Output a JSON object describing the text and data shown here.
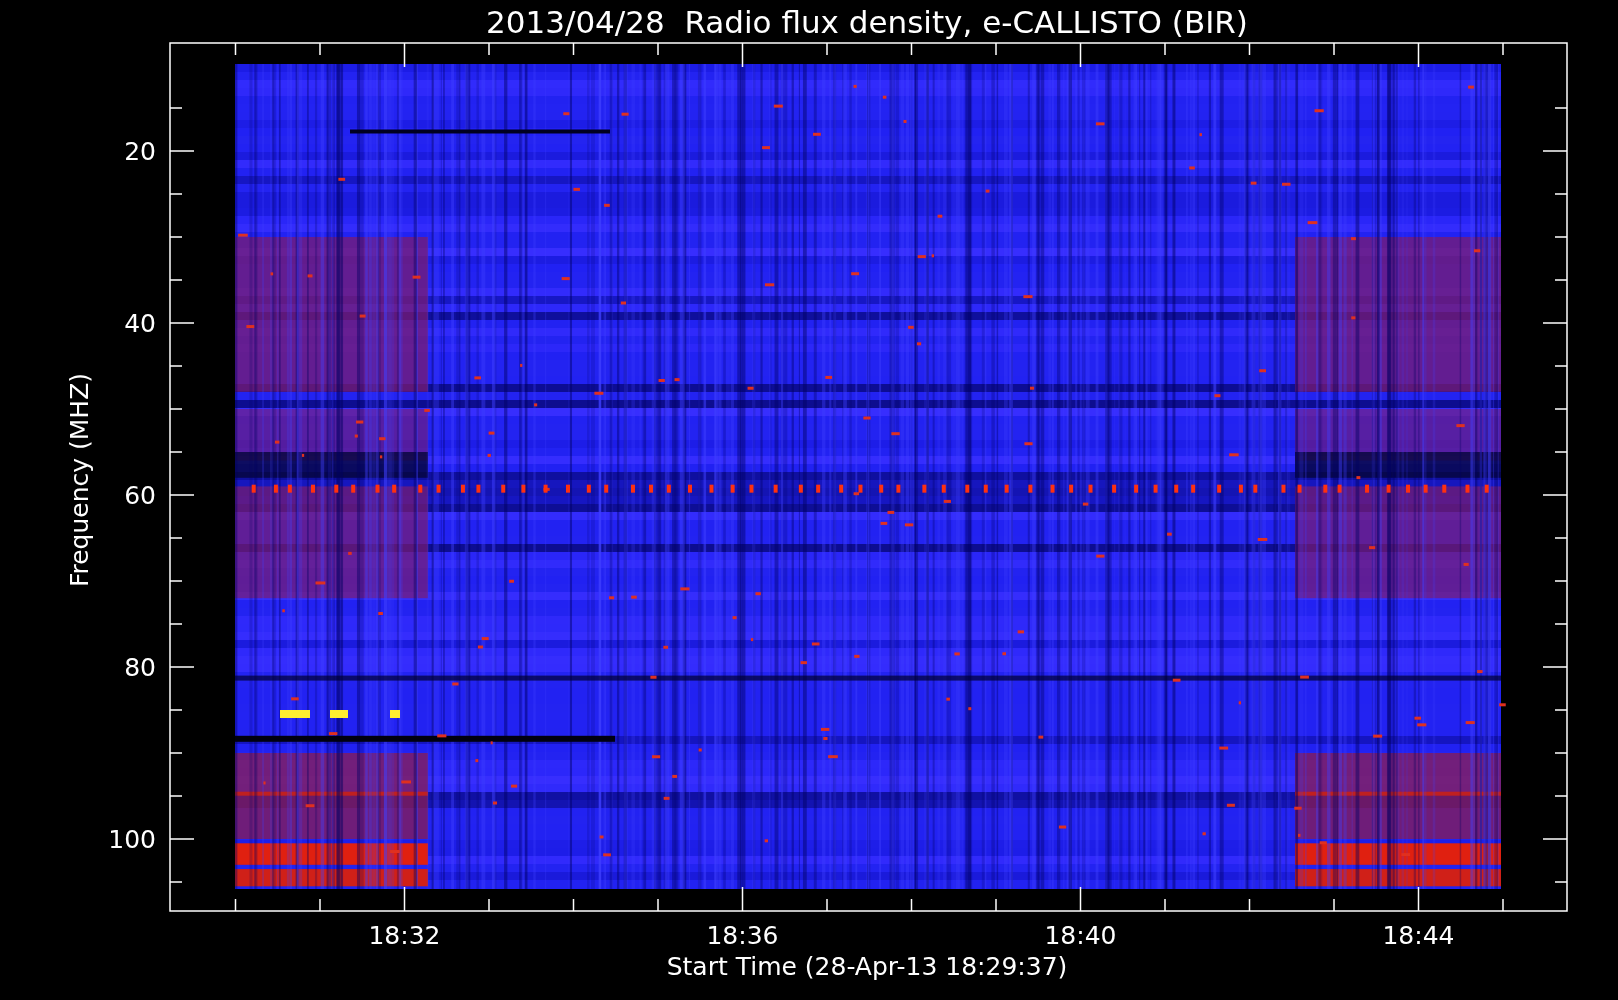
{
  "title": "2013/04/28  Radio flux density, e-CALLISTO (BIR)",
  "y_axis": {
    "label": "Frequency (MHZ)",
    "ticks": [
      "20",
      "40",
      "60",
      "80",
      "100"
    ]
  },
  "x_axis": {
    "label": "Start Time (28-Apr-13 18:29:37)",
    "ticks": [
      "18:32",
      "18:36",
      "18:40",
      "18:44"
    ]
  }
}
